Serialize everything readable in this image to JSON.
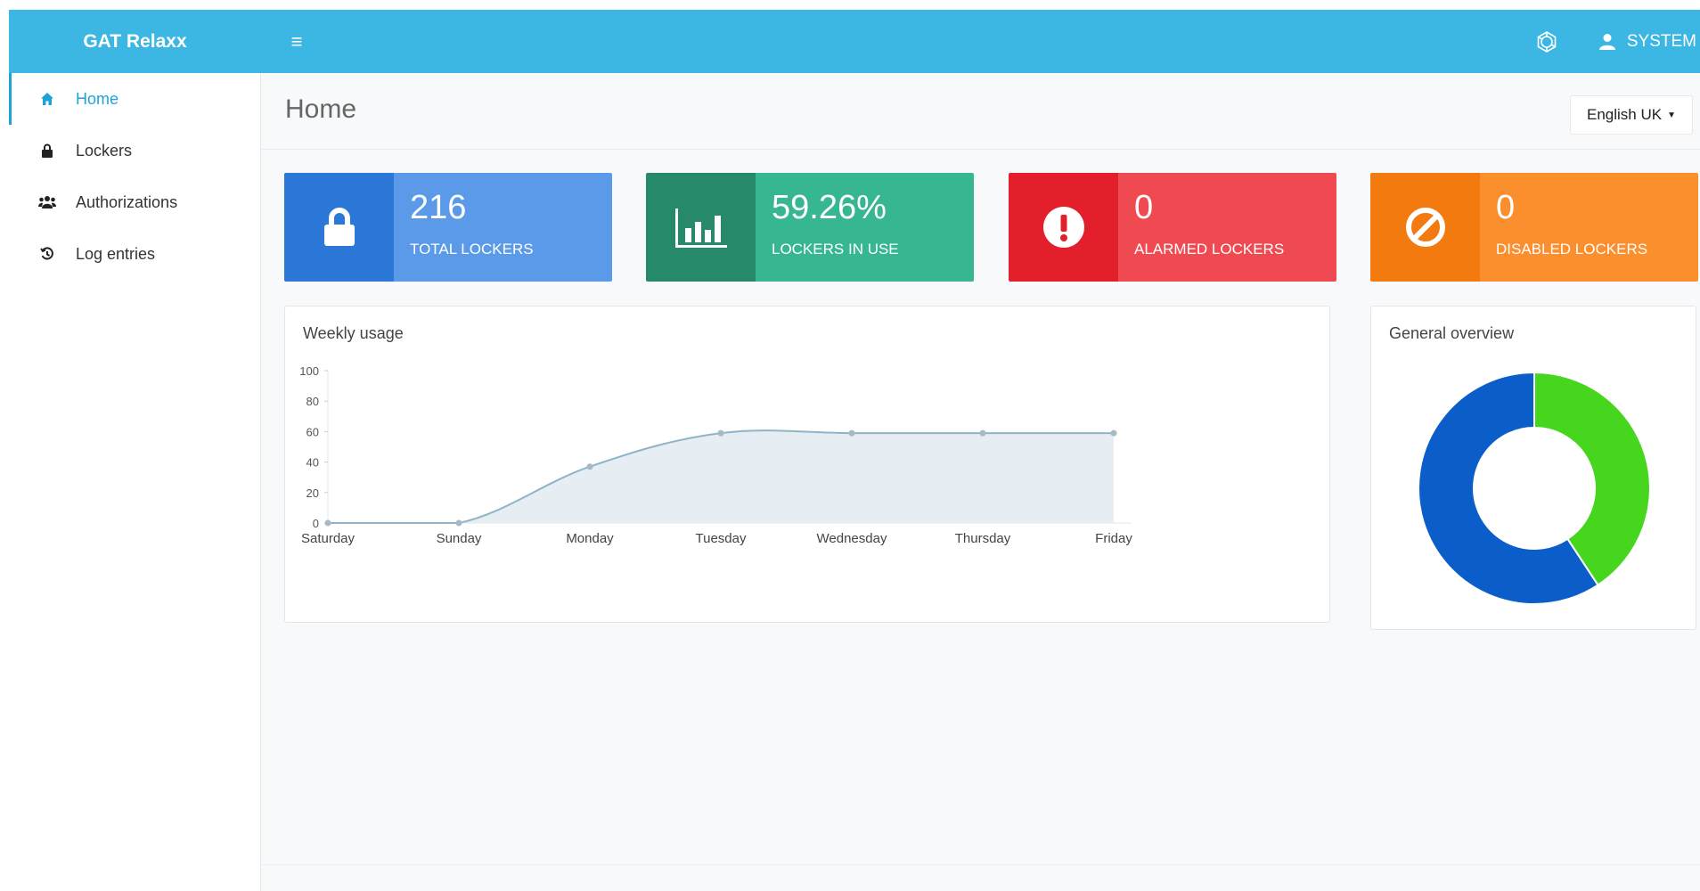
{
  "app": {
    "brand": "GAT Relaxx"
  },
  "topbar": {
    "user": "SYSTEM"
  },
  "sidebar": {
    "items": [
      {
        "label": "Home",
        "icon": "home-icon",
        "active": true
      },
      {
        "label": "Lockers",
        "icon": "lock-icon",
        "active": false
      },
      {
        "label": "Authorizations",
        "icon": "users-icon",
        "active": false
      },
      {
        "label": "Log entries",
        "icon": "history-icon",
        "active": false
      }
    ]
  },
  "page": {
    "title": "Home",
    "language": "English UK"
  },
  "stats": [
    {
      "value": "216",
      "label": "TOTAL LOCKERS",
      "icon": "lock-icon",
      "color_dark": "#2b78d8",
      "color_light": "#5b9ae8"
    },
    {
      "value": "59.26%",
      "label": "LOCKERS IN USE",
      "icon": "bar-chart-icon",
      "color_dark": "#26896c",
      "color_light": "#37b692"
    },
    {
      "value": "0",
      "label": "ALARMED LOCKERS",
      "icon": "alert-icon",
      "color_dark": "#e21f2a",
      "color_light": "#ef4a52"
    },
    {
      "value": "0",
      "label": "DISABLED LOCKERS",
      "icon": "ban-icon",
      "color_dark": "#f37a0f",
      "color_light": "#fb8e2d"
    }
  ],
  "weekly": {
    "title": "Weekly usage"
  },
  "overview": {
    "title": "General overview"
  },
  "chart_data": [
    {
      "type": "area",
      "title": "Weekly usage",
      "categories": [
        "Saturday",
        "Sunday",
        "Monday",
        "Tuesday",
        "Wednesday",
        "Thursday",
        "Friday"
      ],
      "values": [
        0,
        0,
        37,
        59,
        59,
        59,
        59
      ],
      "ylim": [
        0,
        100
      ],
      "yticks": [
        0,
        20,
        40,
        60,
        80,
        100
      ],
      "color": "#8fb4c8"
    },
    {
      "type": "pie",
      "title": "General overview",
      "donut": true,
      "slices": [
        {
          "value": 40.74,
          "color": "#47d61e"
        },
        {
          "value": 59.26,
          "color": "#0b5ec9"
        }
      ]
    }
  ]
}
